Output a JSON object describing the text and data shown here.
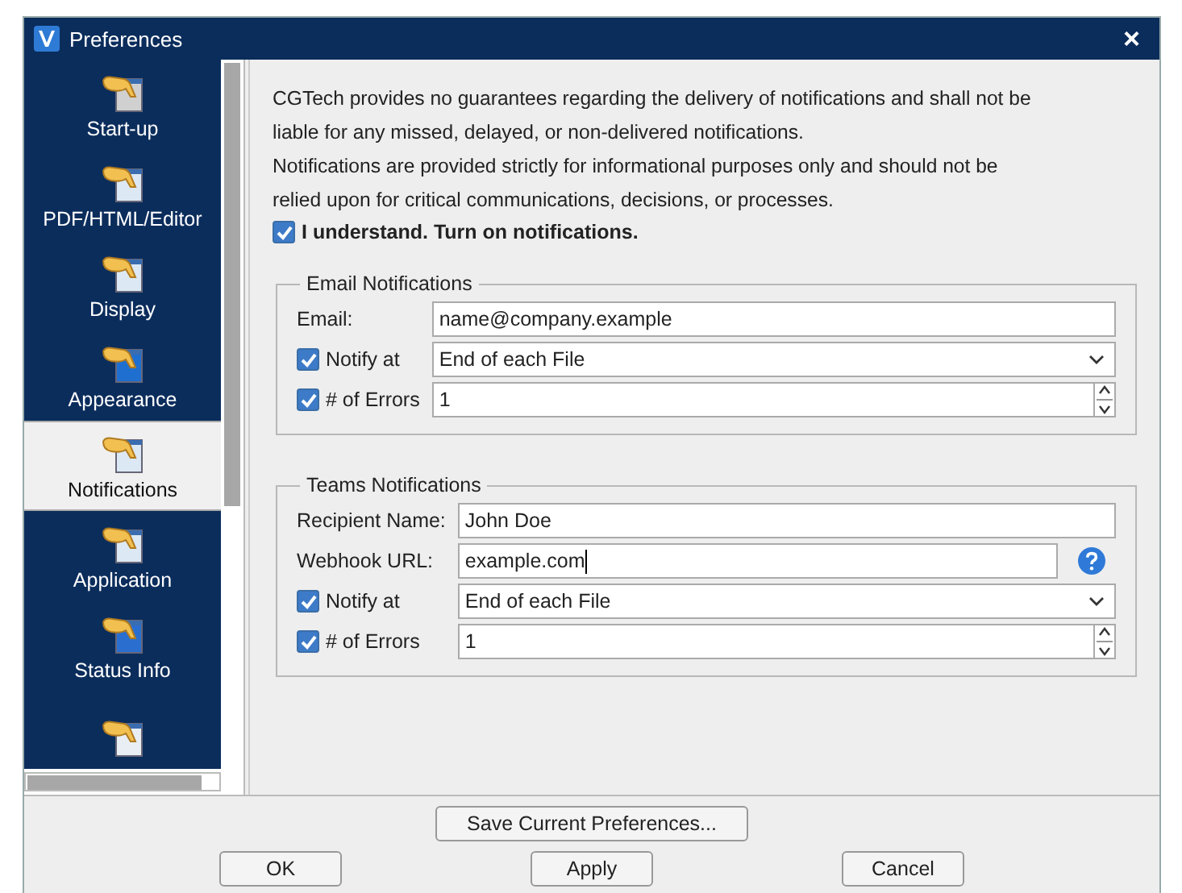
{
  "window": {
    "title": "Preferences",
    "close": "×"
  },
  "sidebar": {
    "items": [
      {
        "label": "Start-up",
        "selected": false
      },
      {
        "label": "PDF/HTML/Editor",
        "selected": false
      },
      {
        "label": "Display",
        "selected": false
      },
      {
        "label": "Appearance",
        "selected": false
      },
      {
        "label": "Notifications",
        "selected": true
      },
      {
        "label": "Application",
        "selected": false
      },
      {
        "label": "Status Info",
        "selected": false
      },
      {
        "selected": false
      }
    ]
  },
  "notice": {
    "paragraphs": [
      "CGTech provides no guarantees regarding the delivery of notifications and shall not be liable for any missed, delayed, or non-delivered notifications.",
      "Notifications are provided strictly for informational purposes only and should not be relied upon for critical communications, decisions, or processes."
    ],
    "consent": {
      "label": "I understand. Turn on notifications.",
      "checked": true
    }
  },
  "groups": [
    {
      "title": "Email Notifications",
      "fields": [
        {
          "kind": "text",
          "label": "Email:",
          "value": "name@company.example"
        },
        {
          "kind": "select",
          "label": "Notify at",
          "checked": true,
          "value": "End of each File"
        },
        {
          "kind": "spinner",
          "label": "# of Errors",
          "checked": true,
          "value": "1"
        }
      ]
    },
    {
      "title": "Teams Notifications",
      "fields": [
        {
          "kind": "text",
          "label": "Recipient Name:",
          "value": "John Doe"
        },
        {
          "kind": "text",
          "label": "Webhook URL:",
          "value": "example.com",
          "focused": true,
          "help": true
        },
        {
          "kind": "select",
          "label": "Notify at",
          "checked": true,
          "value": "End of each File"
        },
        {
          "kind": "spinner",
          "label": "# of Errors",
          "checked": true,
          "value": "1"
        }
      ]
    }
  ],
  "save_button": "Save Current Preferences...",
  "buttons": [
    "OK",
    "Apply",
    "Cancel"
  ]
}
